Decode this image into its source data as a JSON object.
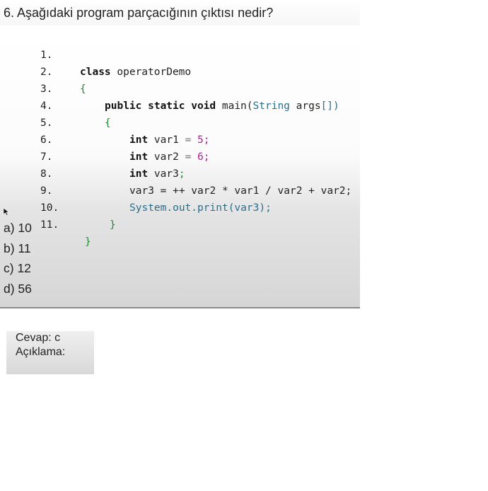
{
  "question": {
    "title": "6. Aşağıdaki program parçacığının çıktısı nedir?"
  },
  "code": {
    "line_numbers": [
      "1.",
      "2.",
      "3.",
      "4.",
      "5.",
      "6.",
      "7.",
      "8.",
      "9.",
      "10.",
      "11."
    ],
    "l1": {
      "kw": "class",
      "rest": " operatorDemo"
    },
    "l2": {
      "brace": "{"
    },
    "l3": {
      "kw": "public static void",
      "method": " main(",
      "type": "String",
      "args": " args",
      "bracket": "[])"
    },
    "l4": {
      "brace": "{"
    },
    "l5": {
      "kw": "int",
      "name": " var1 ",
      "op": "=",
      "val": " 5",
      "semi": ";"
    },
    "l6": {
      "kw": "int",
      "name": " var2 ",
      "op": "=",
      "val": " 6",
      "semi": ";"
    },
    "l7": {
      "kw": "int",
      "name": " var3",
      "semi": ";"
    },
    "l8": {
      "text": "var3 = ++ var2 * var1 / var2 + var2;"
    },
    "l9": {
      "system": "System",
      "rest": ".out.print(var3);"
    },
    "l10": {
      "brace": "}"
    },
    "l11": {
      "brace": "}"
    }
  },
  "options": [
    "a) 10",
    "b) 11",
    "c) 12",
    "d) 56"
  ],
  "answer": {
    "line1": "Cevap: c",
    "line2": "Açıklama:"
  },
  "colors": {
    "keyword": "#111111",
    "type": "#2b6e8a",
    "number": "#b0219a",
    "brace": "#1e8a2f"
  }
}
